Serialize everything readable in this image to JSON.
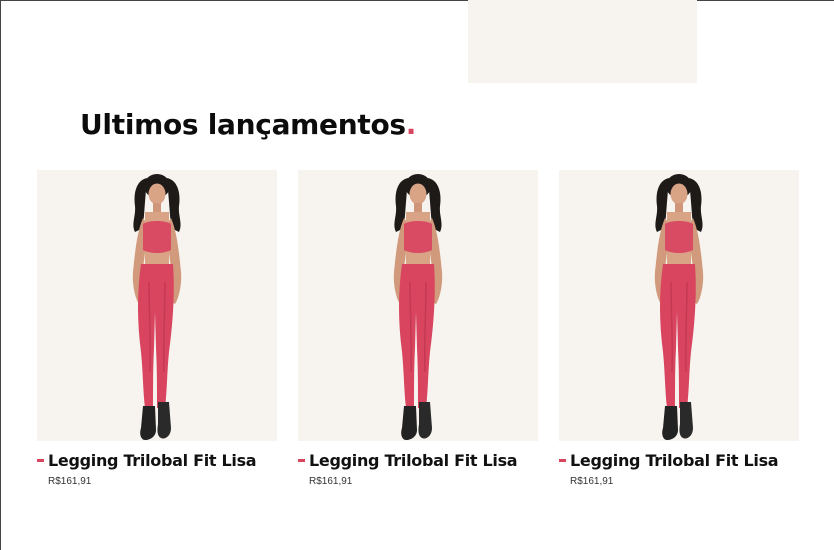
{
  "section": {
    "title": "Ultimos lançamentos",
    "title_dot": ".",
    "accent_color": "#d9455f"
  },
  "products": [
    {
      "name": "Legging Trilobal Fit Lisa",
      "price": "R$161,91"
    },
    {
      "name": "Legging Trilobal Fit Lisa",
      "price": "R$161,91"
    },
    {
      "name": "Legging Trilobal Fit Lisa",
      "price": "R$161,91"
    }
  ]
}
